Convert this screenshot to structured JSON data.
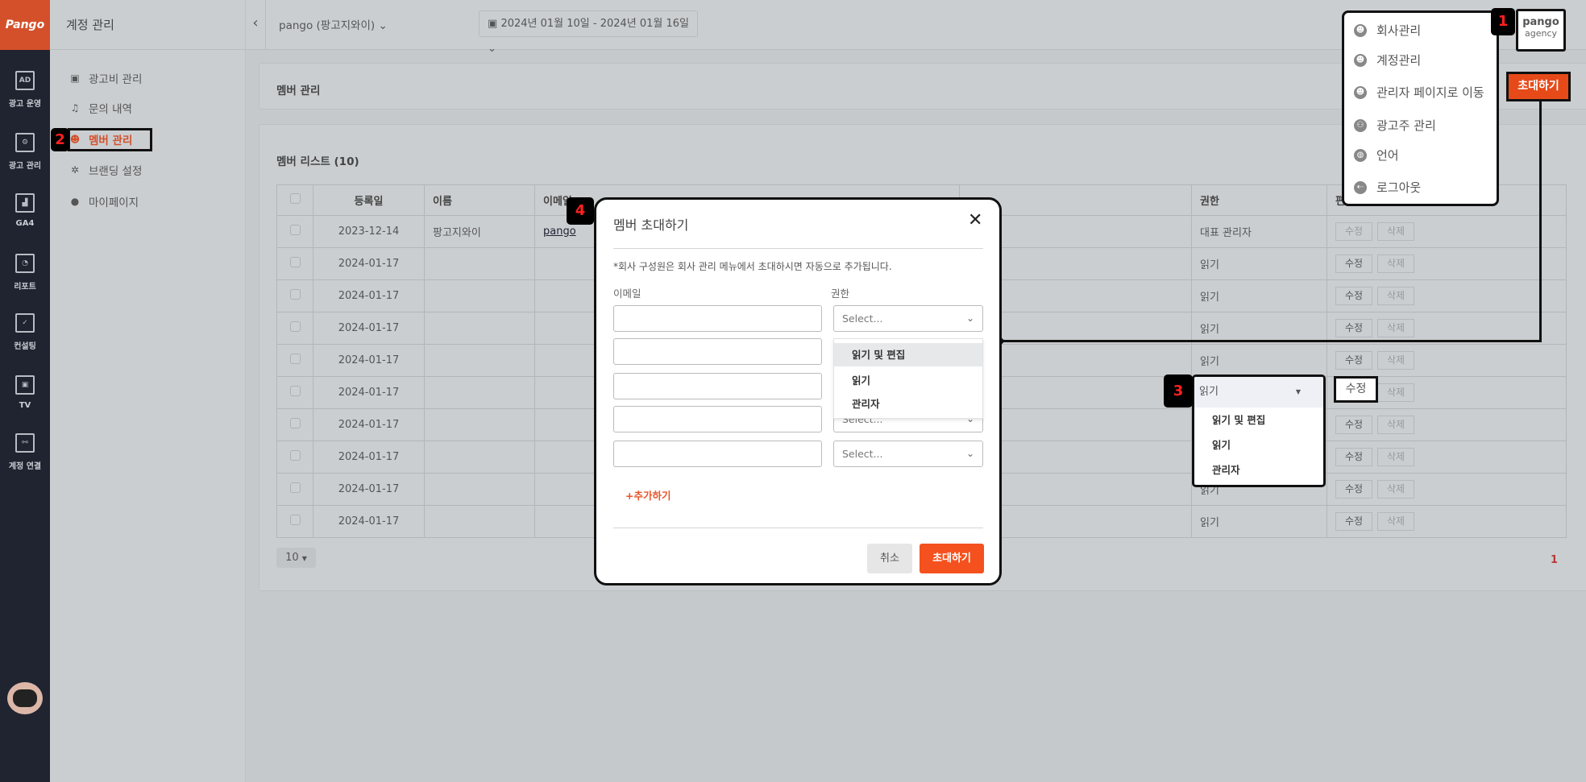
{
  "brand": {
    "logo_text": "Pango",
    "accent": "#f4511e",
    "sidebar_bg": "#1f2430"
  },
  "rail": [
    {
      "label": "광고 운영",
      "icon": "ad-icon",
      "glyph": "AD"
    },
    {
      "label": "광고 관리",
      "icon": "gear-icon",
      "glyph": "⚙"
    },
    {
      "label": "GA4",
      "icon": "bar-chart-icon",
      "glyph": "▟"
    },
    {
      "label": "리포트",
      "icon": "report-icon",
      "glyph": "◔"
    },
    {
      "label": "컨설팅",
      "icon": "consulting-icon",
      "glyph": "✓"
    },
    {
      "label": "TV",
      "icon": "tv-icon",
      "glyph": "▣"
    },
    {
      "label": "계정 연결",
      "icon": "connect-icon",
      "glyph": "⚯"
    }
  ],
  "side": {
    "title": "계정 관리",
    "items": [
      {
        "label": "광고비 관리",
        "icon": "money-icon",
        "glyph": "▣"
      },
      {
        "label": "문의 내역",
        "icon": "headset-icon",
        "glyph": "♫"
      },
      {
        "label": "멤버 관리",
        "icon": "member-icon",
        "glyph": "☻",
        "active": true
      },
      {
        "label": "브랜딩 설정",
        "icon": "cursor-click-icon",
        "glyph": "✲"
      },
      {
        "label": "마이페이지",
        "icon": "user-icon",
        "glyph": "●"
      }
    ]
  },
  "header": {
    "account": "pango (팡고지와이)",
    "date_range": "2024년 01월 10일 - 2024년 01월 16일"
  },
  "page": {
    "title": "멤버 관리",
    "list_title": "멤버 리스트 (10)",
    "invite_label": "초대하기"
  },
  "table": {
    "headers": [
      "",
      "등록일",
      "이름",
      "이메일",
      "",
      "권한",
      "편집"
    ],
    "rows": [
      {
        "date": "2023-12-14",
        "name": "팡고지와이",
        "email": "pango",
        "role": "대표 관리자",
        "edit": "수정",
        "delete": "삭제",
        "edit_disabled": true
      },
      {
        "date": "2024-01-17",
        "name": "",
        "email": "",
        "role": "읽기",
        "edit": "수정",
        "delete": "삭제"
      },
      {
        "date": "2024-01-17",
        "name": "",
        "email": "",
        "role": "읽기",
        "edit": "수정",
        "delete": "삭제"
      },
      {
        "date": "2024-01-17",
        "name": "",
        "email": "",
        "role": "읽기",
        "edit": "수정",
        "delete": "삭제"
      },
      {
        "date": "2024-01-17",
        "name": "",
        "email": "",
        "role": "읽기",
        "edit": "수정",
        "delete": "삭제"
      },
      {
        "date": "2024-01-17",
        "name": "",
        "email": "",
        "role": "",
        "edit": "수정",
        "delete": "삭제"
      },
      {
        "date": "2024-01-17",
        "name": "",
        "email": "",
        "role": "",
        "edit": "수정",
        "delete": "삭제"
      },
      {
        "date": "2024-01-17",
        "name": "",
        "email": "",
        "role": "",
        "edit": "수정",
        "delete": "삭제"
      },
      {
        "date": "2024-01-17",
        "name": "",
        "email": "",
        "role": "읽기",
        "edit": "수정",
        "delete": "삭제"
      },
      {
        "date": "2024-01-17",
        "name": "",
        "email": "",
        "role": "읽기",
        "edit": "수정",
        "delete": "삭제"
      }
    ],
    "page_size": "10",
    "page": "1"
  },
  "user_menu": {
    "items": [
      {
        "label": "회사관리",
        "icon": "company-icon"
      },
      {
        "label": "계정관리",
        "icon": "account-icon"
      },
      {
        "label": "관리자 페이지로 이동",
        "icon": "admin-icon"
      },
      {
        "label": "광고주 관리",
        "icon": "advertiser-icon"
      },
      {
        "label": "언어",
        "icon": "globe-icon"
      },
      {
        "label": "로그아웃",
        "icon": "logout-icon"
      }
    ],
    "user_name": "pango",
    "user_type": "agency"
  },
  "badges": [
    "1",
    "2",
    "3",
    "4"
  ],
  "modal": {
    "title": "멤버 초대하기",
    "note": "*회사 구성원은 회사 관리 메뉴에서 초대하시면 자동으로 추가됩니다.",
    "email_label": "이메일",
    "role_label": "권한",
    "select_placeholder": "Select...",
    "role_options": [
      "읽기 및 편집",
      "읽기",
      "관리자"
    ],
    "add_label": "+추가하기",
    "cancel_label": "취소",
    "submit_label": "초대하기"
  },
  "row_dropdown": {
    "value": "읽기",
    "options": [
      "읽기 및 편집",
      "읽기",
      "관리자"
    ],
    "edit_label": "수정"
  }
}
